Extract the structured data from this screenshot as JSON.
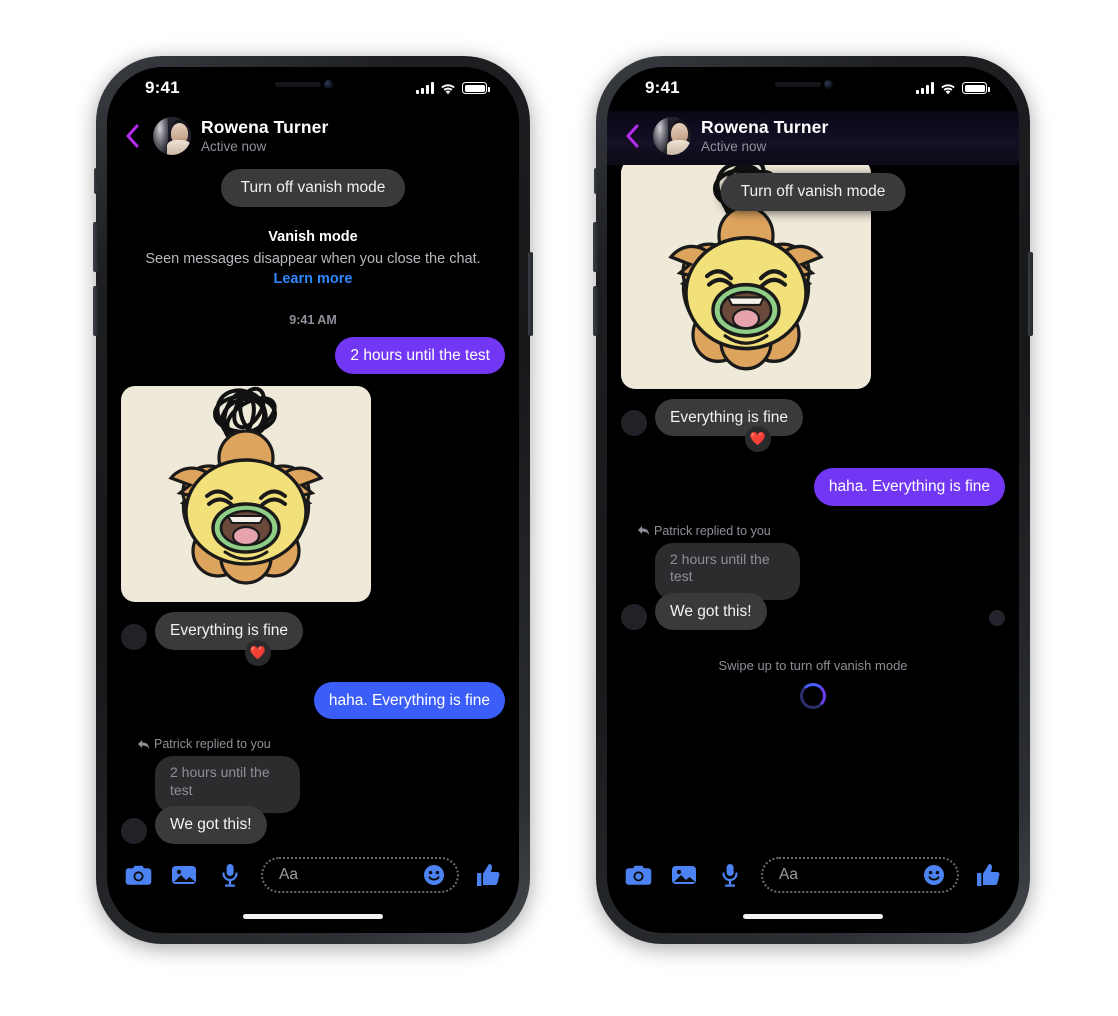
{
  "app": {
    "name": "Messenger",
    "accent_purple": "#7236f5",
    "accent_blue": "#3b5efb",
    "icon_blue": "#4d82f3",
    "bubble_grey": "#3a3a3c",
    "link_blue": "#2d88ff",
    "back_chevron_color": "#b52bf0"
  },
  "status_bar": {
    "time": "9:41",
    "signal_icon": "cellular-bars-icon",
    "wifi_icon": "wifi-icon",
    "battery_icon": "battery-full-icon"
  },
  "header": {
    "back_icon": "back-chevron-icon",
    "avatar_icon": "contact-avatar",
    "name": "Rowena Turner",
    "status": "Active now"
  },
  "phone_left": {
    "vanish_pill": "Turn off vanish mode",
    "vanish_info": {
      "title": "Vanish mode",
      "description": "Seen messages disappear when you close the chat.",
      "link": "Learn more"
    },
    "timestamp": "9:41 AM",
    "messages": [
      {
        "id": "m1",
        "side": "out",
        "type": "text",
        "color": "purple",
        "text": "2 hours until the test"
      },
      {
        "id": "m2",
        "side": "in",
        "type": "sticker",
        "sticker": "crying-flower-sticker"
      },
      {
        "id": "m3",
        "side": "in",
        "type": "text",
        "color": "grey",
        "text": "Everything is fine",
        "reaction": "❤️"
      },
      {
        "id": "m4",
        "side": "out",
        "type": "text",
        "color": "blue",
        "text": "haha. Everything is fine"
      },
      {
        "id": "m5",
        "side": "in",
        "type": "reply",
        "reply_label": "Patrick replied to you",
        "quoted": "2 hours until the test",
        "text": "We got this!"
      }
    ],
    "seen_indicator": "seen-avatar"
  },
  "phone_right": {
    "vanish_pill": "Turn off vanish mode",
    "messages": [
      {
        "id": "r1",
        "side": "in",
        "type": "sticker",
        "sticker": "crying-flower-sticker"
      },
      {
        "id": "r2",
        "side": "in",
        "type": "text",
        "color": "grey",
        "text": "Everything is fine",
        "reaction": "❤️"
      },
      {
        "id": "r3",
        "side": "out",
        "type": "text",
        "color": "purple",
        "text": "haha. Everything is fine"
      },
      {
        "id": "r4",
        "side": "in",
        "type": "reply",
        "reply_label": "Patrick replied to you",
        "quoted": "2 hours until the test",
        "text": "We got this!"
      }
    ],
    "seen_indicator": "seen-avatar",
    "swipe_hint": "Swipe up to turn off vanish mode",
    "spinner": "loading-spinner"
  },
  "composer": {
    "camera_icon": "camera-icon",
    "gallery_icon": "gallery-icon",
    "mic_icon": "microphone-icon",
    "placeholder": "Aa",
    "emoji_icon": "emoji-smiley-icon",
    "like_icon": "thumbs-up-icon"
  },
  "home_indicator": "home-indicator-bar"
}
